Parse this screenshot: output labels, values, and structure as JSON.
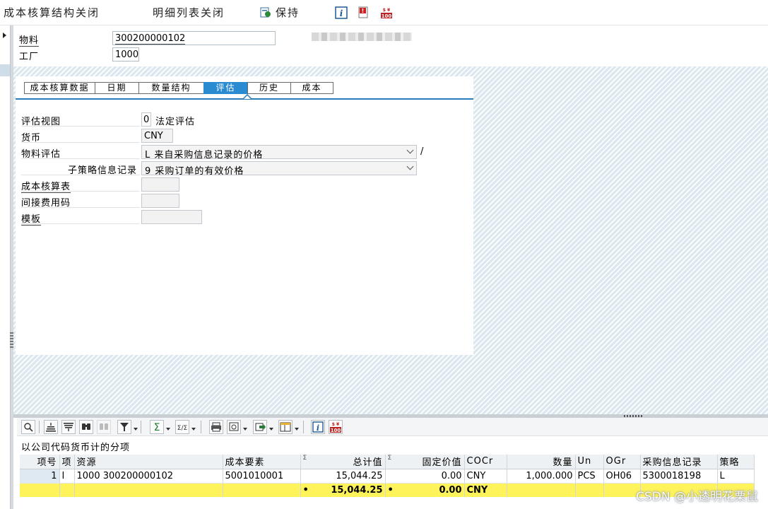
{
  "toolbar": {
    "close_cost_structure": "成本核算结构关闭",
    "close_itemization": "明细列表关闭",
    "save": "保持",
    "icons": [
      "info-icon",
      "alert-icon",
      "currency-icon"
    ]
  },
  "header": {
    "material_label": "物料",
    "material_value": "300200000102",
    "plant_label": "工厂",
    "plant_value": "1000"
  },
  "tabs": [
    {
      "label": "成本核算数据",
      "active": false
    },
    {
      "label": "日期",
      "active": false
    },
    {
      "label": "数量结构",
      "active": false
    },
    {
      "label": "评估",
      "active": true
    },
    {
      "label": "历史",
      "active": false
    },
    {
      "label": "成本",
      "active": false
    }
  ],
  "valuation": {
    "view_label": "评估视图",
    "view_code": "0",
    "view_text": "法定评估",
    "currency_label": "货币",
    "currency_value": "CNY",
    "material_valuation_label": "物料评估",
    "material_valuation_value": "L 来自采购信息记录的价格",
    "slash": "/",
    "sub_strategy_label": "子策略信息记录",
    "sub_strategy_value": "9 采购订单的有效价格",
    "costing_sheet_label": "成本核算表",
    "costing_sheet_value": "",
    "overhead_key_label": "间接费用码",
    "overhead_key_value": "",
    "template_label": "模板",
    "template_value": ""
  },
  "alv": {
    "title": "以公司代码货币计的分项",
    "columns": [
      "项号",
      "项",
      "资源",
      "成本要素",
      "总计值",
      "固定价值",
      "COCr",
      "数量",
      "Un",
      "OGr",
      "采购信息记录",
      "策略"
    ],
    "rows": [
      {
        "item_no": "1",
        "cat": "I",
        "resource": "1000 300200000102",
        "cost_element": "5001010001",
        "total": "15,044.25",
        "fixed": "0.00",
        "cocr": "CNY",
        "qty": "1,000.000",
        "un": "PCS",
        "ogr": "OH06",
        "info_record": "5300018198",
        "strategy": "L"
      }
    ],
    "totals": {
      "dot1": "•",
      "total": "15,044.25",
      "dot2": "•",
      "fixed": "0.00",
      "cocr": "CNY"
    }
  },
  "watermark": "CSDN @小透明花栗鼠",
  "colors": {
    "active_tab": "#2b8bd1",
    "total_row": "#fff35c",
    "tab_rule": "#2b7bb8"
  }
}
